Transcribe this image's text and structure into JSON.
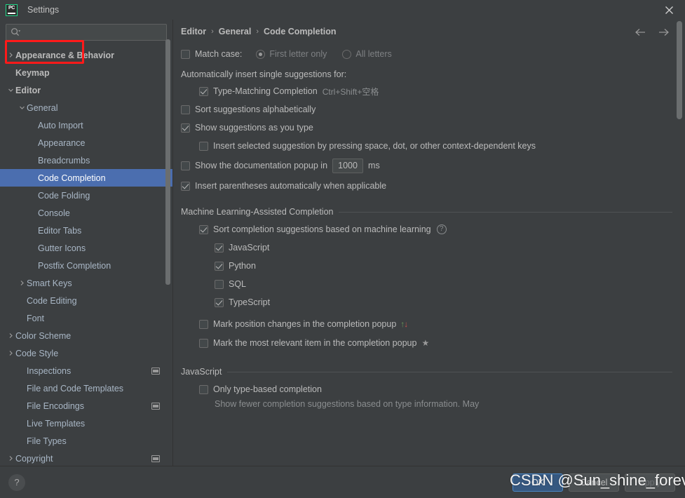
{
  "window": {
    "app_icon_text": "PC",
    "title": "Settings",
    "close_icon": "close-icon"
  },
  "sidebar": {
    "search": {
      "placeholder": "",
      "value": "",
      "icon": "search-icon"
    },
    "items": [
      {
        "label": "Appearance & Behavior",
        "indent": 0,
        "twisty": "collapsed",
        "bold": true,
        "selected": false,
        "badge": false
      },
      {
        "label": "Keymap",
        "indent": 0,
        "twisty": "none",
        "bold": true,
        "selected": false,
        "badge": false
      },
      {
        "label": "Editor",
        "indent": 0,
        "twisty": "expanded",
        "bold": true,
        "selected": false,
        "badge": false
      },
      {
        "label": "General",
        "indent": 1,
        "twisty": "expanded",
        "bold": false,
        "selected": false,
        "badge": false
      },
      {
        "label": "Auto Import",
        "indent": 2,
        "twisty": "none",
        "bold": false,
        "selected": false,
        "badge": false
      },
      {
        "label": "Appearance",
        "indent": 2,
        "twisty": "none",
        "bold": false,
        "selected": false,
        "badge": false
      },
      {
        "label": "Breadcrumbs",
        "indent": 2,
        "twisty": "none",
        "bold": false,
        "selected": false,
        "badge": false
      },
      {
        "label": "Code Completion",
        "indent": 2,
        "twisty": "none",
        "bold": false,
        "selected": true,
        "badge": false
      },
      {
        "label": "Code Folding",
        "indent": 2,
        "twisty": "none",
        "bold": false,
        "selected": false,
        "badge": false
      },
      {
        "label": "Console",
        "indent": 2,
        "twisty": "none",
        "bold": false,
        "selected": false,
        "badge": false
      },
      {
        "label": "Editor Tabs",
        "indent": 2,
        "twisty": "none",
        "bold": false,
        "selected": false,
        "badge": false
      },
      {
        "label": "Gutter Icons",
        "indent": 2,
        "twisty": "none",
        "bold": false,
        "selected": false,
        "badge": false
      },
      {
        "label": "Postfix Completion",
        "indent": 2,
        "twisty": "none",
        "bold": false,
        "selected": false,
        "badge": false
      },
      {
        "label": "Smart Keys",
        "indent": 1,
        "twisty": "collapsed",
        "bold": false,
        "selected": false,
        "badge": false
      },
      {
        "label": "Code Editing",
        "indent": 1,
        "twisty": "none",
        "bold": false,
        "selected": false,
        "badge": false
      },
      {
        "label": "Font",
        "indent": 1,
        "twisty": "none",
        "bold": false,
        "selected": false,
        "badge": false
      },
      {
        "label": "Color Scheme",
        "indent": 0,
        "twisty": "collapsed",
        "bold": false,
        "selected": false,
        "badge": false
      },
      {
        "label": "Code Style",
        "indent": 0,
        "twisty": "collapsed",
        "bold": false,
        "selected": false,
        "badge": false
      },
      {
        "label": "Inspections",
        "indent": 1,
        "twisty": "none",
        "bold": false,
        "selected": false,
        "badge": true
      },
      {
        "label": "File and Code Templates",
        "indent": 1,
        "twisty": "none",
        "bold": false,
        "selected": false,
        "badge": false
      },
      {
        "label": "File Encodings",
        "indent": 1,
        "twisty": "none",
        "bold": false,
        "selected": false,
        "badge": true
      },
      {
        "label": "Live Templates",
        "indent": 1,
        "twisty": "none",
        "bold": false,
        "selected": false,
        "badge": false
      },
      {
        "label": "File Types",
        "indent": 1,
        "twisty": "none",
        "bold": false,
        "selected": false,
        "badge": false
      },
      {
        "label": "Copyright",
        "indent": 0,
        "twisty": "collapsed",
        "bold": false,
        "selected": false,
        "badge": true
      }
    ]
  },
  "breadcrumb": {
    "crumb1": "Editor",
    "crumb2": "General",
    "crumb3": "Code Completion",
    "separator": "›",
    "back_icon": "arrow-left-icon",
    "forward_icon": "arrow-right-icon"
  },
  "main": {
    "match_case": {
      "label": "Match case:",
      "checked": false,
      "options": [
        {
          "label": "First letter only",
          "selected": true
        },
        {
          "label": "All letters",
          "selected": false
        }
      ]
    },
    "auto_insert_label": "Automatically insert single suggestions for:",
    "type_matching": {
      "label": "Type-Matching Completion",
      "shortcut": "Ctrl+Shift+空格",
      "checked": true
    },
    "sort_alphabetically": {
      "label": "Sort suggestions alphabetically",
      "checked": false
    },
    "show_as_you_type": {
      "label": "Show suggestions as you type",
      "checked": true
    },
    "insert_selected": {
      "label": "Insert selected suggestion by pressing space, dot, or other context-dependent keys",
      "checked": false
    },
    "doc_popup": {
      "label_before": "Show the documentation popup in",
      "value": "1000",
      "label_after": "ms",
      "checked": false
    },
    "insert_parentheses": {
      "label": "Insert parentheses automatically when applicable",
      "checked": true
    },
    "ml_group": {
      "title": "Machine Learning-Assisted Completion",
      "sort_ml": {
        "label": "Sort completion suggestions based on machine learning",
        "checked": true,
        "help_icon": "help-circle-icon"
      },
      "languages": [
        {
          "label": "JavaScript",
          "checked": true
        },
        {
          "label": "Python",
          "checked": true
        },
        {
          "label": "SQL",
          "checked": false
        },
        {
          "label": "TypeScript",
          "checked": true
        }
      ],
      "mark_position": {
        "label": "Mark position changes in the completion popup",
        "checked": false,
        "icon_up": "↑",
        "icon_down": "↓"
      },
      "mark_relevant": {
        "label": "Mark the most relevant item in the completion popup",
        "checked": false,
        "icon": "★"
      }
    },
    "javascript_group": {
      "title": "JavaScript",
      "only_type_based": {
        "label": "Only type-based completion",
        "checked": false
      },
      "description": "Show fewer completion suggestions based on type information. May"
    }
  },
  "footer": {
    "help_label": "?",
    "buttons": [
      {
        "label": "OK",
        "style": "primary"
      },
      {
        "label": "Cancel",
        "style": "normal"
      },
      {
        "label": "Apply",
        "style": "disabled"
      }
    ]
  },
  "overlay": {
    "watermark": "CSDN @Sun_shine_forever",
    "annotation_color": "#ff1a1a"
  }
}
